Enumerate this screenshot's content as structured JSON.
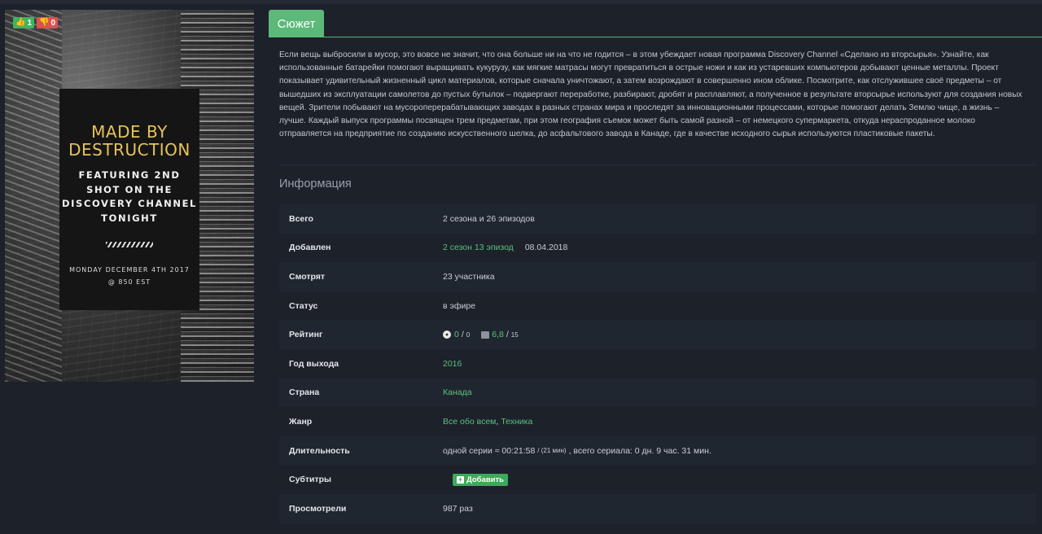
{
  "poster": {
    "title": "MADE BY DESTRUCTION",
    "subtitle": "FEATURING 2ND SHOT ON THE DISCOVERY CHANNEL TONIGHT",
    "date_line1": "MONDAY DECEMBER 4TH 2017",
    "date_line2": "@ 850 EST",
    "likes": "1",
    "dislikes": "0"
  },
  "tab": {
    "label": "Сюжет"
  },
  "plot": "Если вещь выбросили в мусор, это вовсе не значит, что она больше ни на что не годится – в этом убеждает новая программа Discovery Channel «Сделано из вторсырья». Узнайте, как использованные батарейки помогают выращивать кукурузу, как мягкие матрасы могут превратиться в острые ножи и как из устаревших компьютеров добывают ценные металлы. Проект показывает удивительный жизненный цикл материалов, которые сначала уничтожают, а затем возрождают в совершенно ином облике. Посмотрите, как отслужившее своё предметы – от вышедших из эксплуатации самолетов до пустых бутылок – подвергают переработке, разбирают, дробят и расплавляют, а полученное в результате вторсырье используют для создания новых вещей. Зрители побывают на мусороперерабатывающих заводах в разных странах мира и проследят за инновационными процессами, которые помогают делать Землю чище, а жизнь – лучше. Каждый выпуск программы посвящен трем предметам, при этом география съемок может быть самой разной – от немецкого супермаркета, откуда нераспроданное молоко отправляется на предприятие по созданию искусственного шелка, до асфальтового завода в Канаде, где в качестве исходного сырья используются пластиковые пакеты.",
  "info": {
    "heading": "Информация",
    "total": {
      "label": "Всего",
      "value": "2 сезона и 26 эпизодов"
    },
    "added": {
      "label": "Добавлен",
      "link": "2 сезон 13 эпизод",
      "date": "08.04.2018"
    },
    "watching": {
      "label": "Смотрят",
      "value": "23 участника"
    },
    "status": {
      "label": "Статус",
      "value": "в эфире"
    },
    "rating": {
      "label": "Рейтинг",
      "site_value": "0",
      "site_sep": "/",
      "site_votes": "0",
      "imdb_value": "6,8",
      "imdb_sep": "/",
      "imdb_votes": "15"
    },
    "year": {
      "label": "Год выхода",
      "value": "2016"
    },
    "country": {
      "label": "Страна",
      "value": "Канада"
    },
    "genre": {
      "label": "Жанр",
      "genre1": "Все обо всем",
      "comma": ",",
      "genre2": "Техника"
    },
    "duration": {
      "label": "Длительность",
      "prefix": "одной серии ≈ 00:21:58",
      "small": "/ (21 мин)",
      "suffix": ", всего сериала: 0 дн. 9 час. 31 мин."
    },
    "subtitles": {
      "label": "Субтитры",
      "button": "Добавить"
    },
    "views": {
      "label": "Просмотрели",
      "value": "987 раз"
    }
  }
}
